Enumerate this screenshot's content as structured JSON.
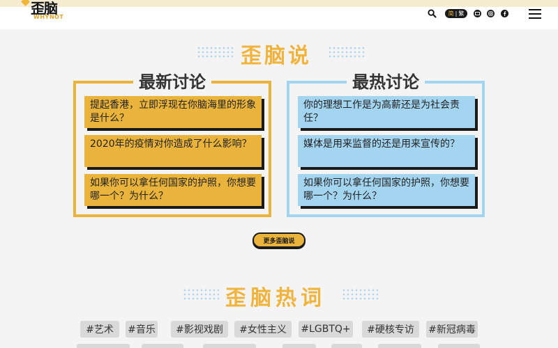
{
  "header": {
    "logo_text": "歪脑",
    "logo_sub": "WHYNOT",
    "lang_current": "简",
    "lang_sep": "|",
    "lang_other": "繁",
    "icons": [
      "search-icon",
      "email-icon",
      "instagram-icon",
      "facebook-icon",
      "menu-icon"
    ]
  },
  "section1": {
    "title": "歪脑说",
    "latest": {
      "title": "最新讨论",
      "items": [
        "提起香港，立即浮现在你脑海里的形象是什么？",
        "2020年的疫情对你造成了什么影响？",
        "如果你可以拿任何国家的护照，你想要哪一个？为什么？"
      ]
    },
    "hot": {
      "title": "最热讨论",
      "items": [
        "你的理想工作是为高薪还是为社会责任？",
        "媒体是用来监督的还是用来宣传的？",
        "如果你可以拿任何国家的护照，你想要哪一个？为什么？"
      ]
    },
    "more_label": "更多歪脑说"
  },
  "section2": {
    "title": "歪脑热词",
    "tags": [
      "#艺术",
      "#音乐",
      "#影视戏剧",
      "#女性主义",
      "#LGBTQ+",
      "#硬核专访",
      "#新冠病毒"
    ]
  },
  "colors": {
    "accent_yellow": "#eab43c",
    "accent_blue": "#a3d4f0",
    "background": "#f4f4f4"
  }
}
